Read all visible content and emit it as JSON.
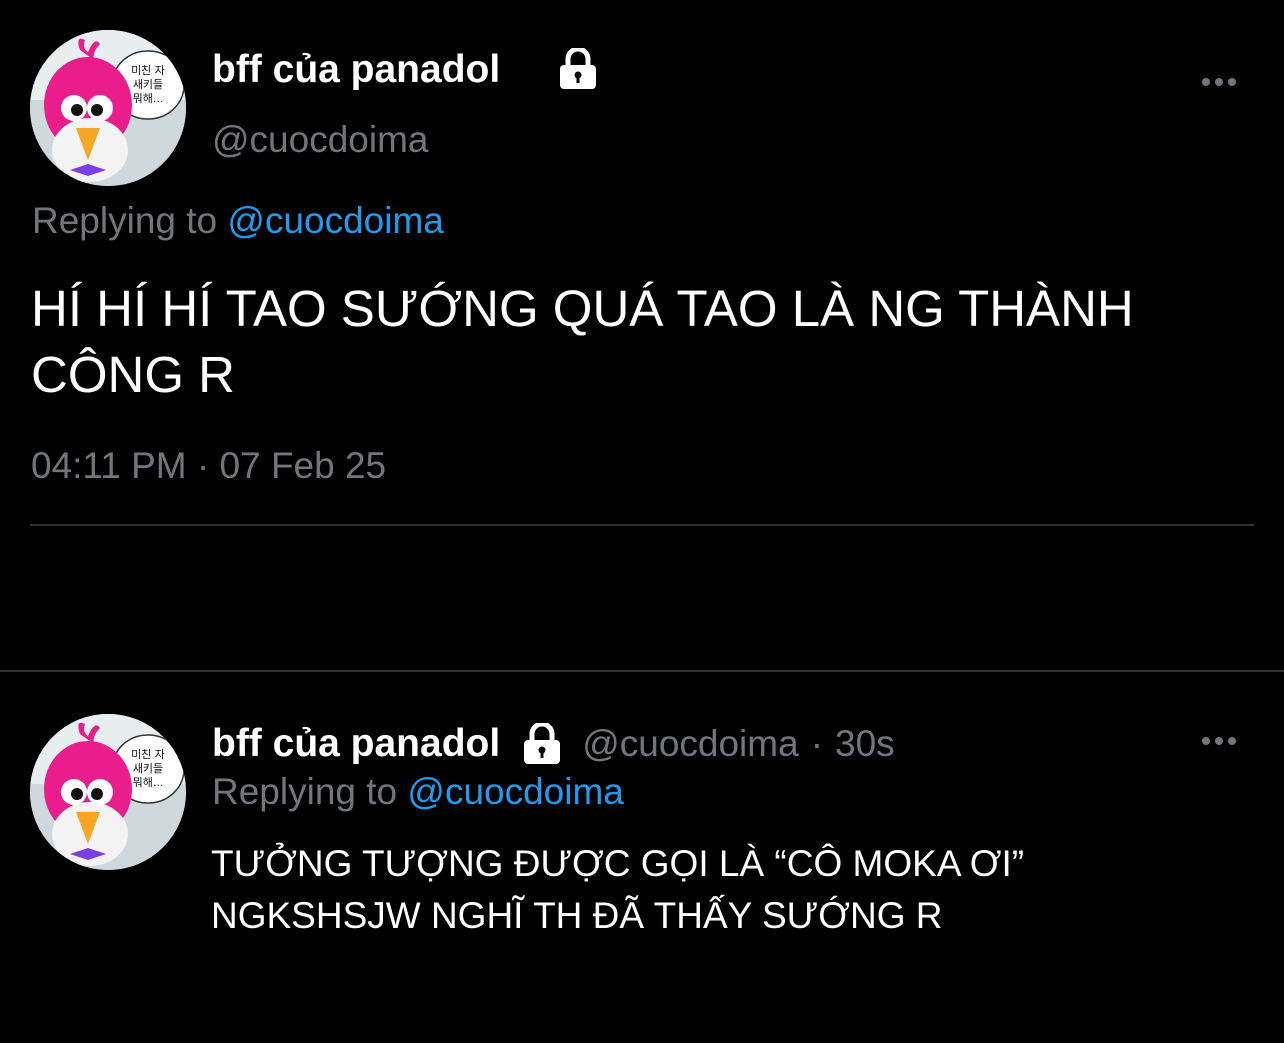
{
  "main_tweet": {
    "display_name": "bff của panadol",
    "handle": "@cuocdoima",
    "replying_prefix": "Replying to",
    "replying_handle": "@cuocdoima",
    "text_line1": "HÍ HÍ HÍ TAO SƯỚNG QUÁ TAO LÀ NG THÀNH",
    "text_line2": "CÔNG R",
    "timestamp": "04:11 PM · 07 Feb 25",
    "avatar_bubble_text": [
      "미친 자",
      "새키들",
      "뭐해..."
    ]
  },
  "reply_tweet": {
    "display_name": "bff của panadol",
    "handle": "@cuocdoima",
    "separator": "·",
    "time": "30s",
    "replying_prefix": "Replying to",
    "replying_handle": "@cuocdoima",
    "text_line1": "TƯỞNG TƯỢNG ĐƯỢC GỌI LÀ “CÔ MOKA ƠI”",
    "text_line2": "NGKSHSJW NGHĨ TH ĐÃ THẤY SƯỚNG R",
    "avatar_bubble_text": [
      "미친 자",
      "새키들",
      "뭐해..."
    ]
  },
  "icons": {
    "reply": "reply-icon",
    "retweet": "retweet-icon",
    "like": "heart-icon",
    "analytics": "analytics-icon",
    "share": "share-icon",
    "lock": "lock-icon",
    "more": "more-icon"
  },
  "colors": {
    "background": "#000000",
    "text": "#e7e9ea",
    "muted": "#71767b",
    "link": "#1d9bf0",
    "divider": "#2f3336"
  }
}
